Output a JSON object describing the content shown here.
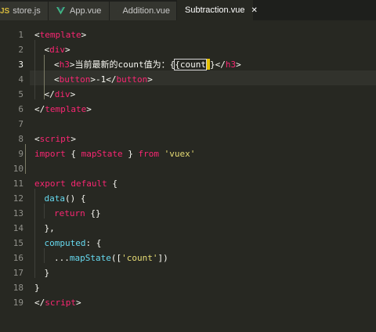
{
  "tabs": [
    {
      "label": "store.js",
      "icon": "js-file-icon",
      "active": false
    },
    {
      "label": "App.vue",
      "icon": "vue-file-icon",
      "active": false
    },
    {
      "label": "Addition.vue",
      "icon": "vue-file-icon",
      "active": false
    },
    {
      "label": "Subtraction.vue",
      "icon": "vue-file-icon",
      "active": true
    }
  ],
  "icon_glyphs": {
    "js": "JS",
    "close": "✕"
  },
  "colors": {
    "vue_green": "#41b883",
    "tag": "#f92672",
    "string": "#e6db74",
    "function": "#66d9ef"
  },
  "editor": {
    "current_line": 3,
    "lines": [
      {
        "no": "1",
        "indent": 0,
        "parts": [
          [
            "p",
            "<"
          ],
          [
            "tag",
            "template"
          ],
          [
            "p",
            ">"
          ]
        ]
      },
      {
        "no": "2",
        "indent": 1,
        "parts": [
          [
            "p",
            "<"
          ],
          [
            "tag",
            "div"
          ],
          [
            "p",
            ">"
          ]
        ]
      },
      {
        "no": "3",
        "indent": 2,
        "parts": [
          [
            "p",
            "<"
          ],
          [
            "tag",
            "h3"
          ],
          [
            "p",
            ">当前最新的count值为：{"
          ],
          [
            "cw",
            "{count"
          ],
          [
            "caret",
            ""
          ],
          [
            "p",
            "}</"
          ],
          [
            "tag",
            "h3"
          ],
          [
            "p",
            ">"
          ]
        ]
      },
      {
        "no": "4",
        "indent": 2,
        "parts": [
          [
            "p",
            "<"
          ],
          [
            "tag",
            "button"
          ],
          [
            "p",
            ">-1</"
          ],
          [
            "tag",
            "button"
          ],
          [
            "p",
            ">"
          ]
        ]
      },
      {
        "no": "5",
        "indent": 1,
        "parts": [
          [
            "p",
            "</"
          ],
          [
            "tag",
            "div"
          ],
          [
            "p",
            ">"
          ]
        ]
      },
      {
        "no": "6",
        "indent": 0,
        "parts": [
          [
            "p",
            "</"
          ],
          [
            "tag",
            "template"
          ],
          [
            "p",
            ">"
          ]
        ]
      },
      {
        "no": "7",
        "indent": 0,
        "parts": []
      },
      {
        "no": "8",
        "indent": 0,
        "parts": [
          [
            "p",
            "<"
          ],
          [
            "tag",
            "script"
          ],
          [
            "p",
            ">"
          ]
        ]
      },
      {
        "no": "9",
        "indent": 0,
        "parts": [
          [
            "kw",
            "import"
          ],
          [
            "p",
            " { "
          ],
          [
            "tag",
            "mapState"
          ],
          [
            "p",
            " } "
          ],
          [
            "kw",
            "from"
          ],
          [
            "p",
            " "
          ],
          [
            "str",
            "'vuex'"
          ]
        ]
      },
      {
        "no": "10",
        "indent": 0,
        "parts": []
      },
      {
        "no": "11",
        "indent": 0,
        "parts": [
          [
            "kw",
            "export"
          ],
          [
            "p",
            " "
          ],
          [
            "kw",
            "default"
          ],
          [
            "p",
            " {"
          ]
        ]
      },
      {
        "no": "12",
        "indent": 1,
        "parts": [
          [
            "fn",
            "data"
          ],
          [
            "p",
            "() {"
          ]
        ]
      },
      {
        "no": "13",
        "indent": 2,
        "parts": [
          [
            "kw",
            "return"
          ],
          [
            "p",
            " {}"
          ]
        ]
      },
      {
        "no": "14",
        "indent": 1,
        "parts": [
          [
            "p",
            "},"
          ]
        ]
      },
      {
        "no": "15",
        "indent": 1,
        "parts": [
          [
            "fn",
            "computed"
          ],
          [
            "p",
            ": {"
          ]
        ]
      },
      {
        "no": "16",
        "indent": 2,
        "parts": [
          [
            "p",
            "..."
          ],
          [
            "fn",
            "mapState"
          ],
          [
            "p",
            "(["
          ],
          [
            "str",
            "'count'"
          ],
          [
            "p",
            "])"
          ]
        ]
      },
      {
        "no": "17",
        "indent": 1,
        "parts": [
          [
            "p",
            "}"
          ]
        ]
      },
      {
        "no": "18",
        "indent": 0,
        "parts": [
          [
            "p",
            "}"
          ]
        ]
      },
      {
        "no": "19",
        "indent": 0,
        "parts": [
          [
            "p",
            "</"
          ],
          [
            "tag",
            "script"
          ],
          [
            "p",
            ">"
          ]
        ]
      }
    ]
  }
}
